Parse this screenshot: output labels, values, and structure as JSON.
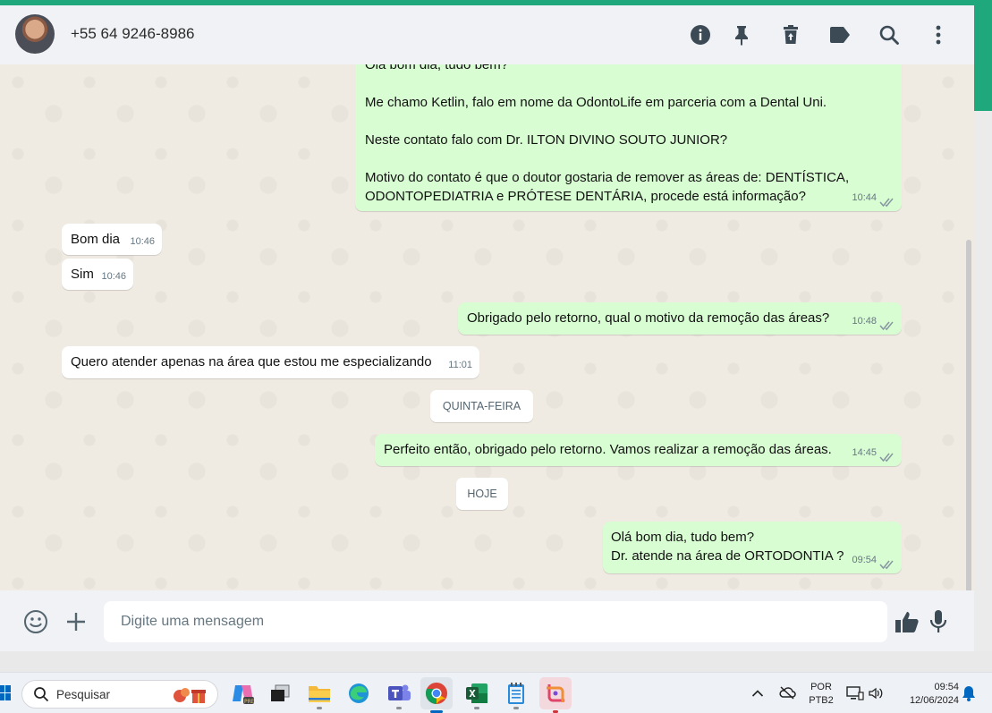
{
  "header": {
    "contact_name": "+55 64 9246-8986",
    "icons": [
      "info-icon",
      "pin-icon",
      "trash-icon",
      "label-icon",
      "search-icon",
      "more-icon"
    ]
  },
  "messages": [
    {
      "dir": "out",
      "lines": [
        "Olá bom dia, tudo bem?",
        "",
        "Me chamo Ketlin, falo em nome da OdontoLife em parceria com a Dental Uni.",
        "",
        "Neste contato falo com Dr. ILTON DIVINO SOUTO JUNIOR?",
        "",
        "Motivo do contato é que o doutor gostaria de remover as áreas de: DENTÍSTICA,",
        "ODONTOPEDIATRIA e PRÓTESE DENTÁRIA, procede está informação?"
      ],
      "time": "10:44",
      "read": true
    },
    {
      "dir": "in",
      "text": "Bom dia",
      "time": "10:46"
    },
    {
      "dir": "in",
      "text": "Sim",
      "time": "10:46"
    },
    {
      "dir": "out",
      "text": "Obrigado pelo retorno, qual o motivo da remoção das áreas?",
      "time": "10:48",
      "read": true
    },
    {
      "dir": "in",
      "text": "Quero atender apenas na área que estou me especializando",
      "time": "11:01"
    },
    {
      "dir": "day",
      "text": "QUINTA-FEIRA"
    },
    {
      "dir": "out",
      "text": "Perfeito então, obrigado pelo retorno. Vamos realizar a remoção das áreas.",
      "time": "14:45",
      "read": true
    },
    {
      "dir": "day",
      "text": "HOJE"
    },
    {
      "dir": "out",
      "lines": [
        "Olá bom dia, tudo bem?",
        "Dr. atende na área de ORTODONTIA ?"
      ],
      "time": "09:54",
      "read": true
    }
  ],
  "composer": {
    "placeholder": "Digite uma mensagem"
  },
  "taskbar": {
    "search_label": "Pesquisar",
    "lang_top": "POR",
    "lang_bottom": "PTB2",
    "clock_time": "09:54",
    "clock_date": "12/06/2024"
  },
  "colors": {
    "accent": "#1fa87c",
    "outgoing_bubble": "#d9fdd3",
    "incoming_bubble": "#ffffff",
    "chat_background": "#efeae2",
    "read_ticks": "#53bdeb"
  }
}
